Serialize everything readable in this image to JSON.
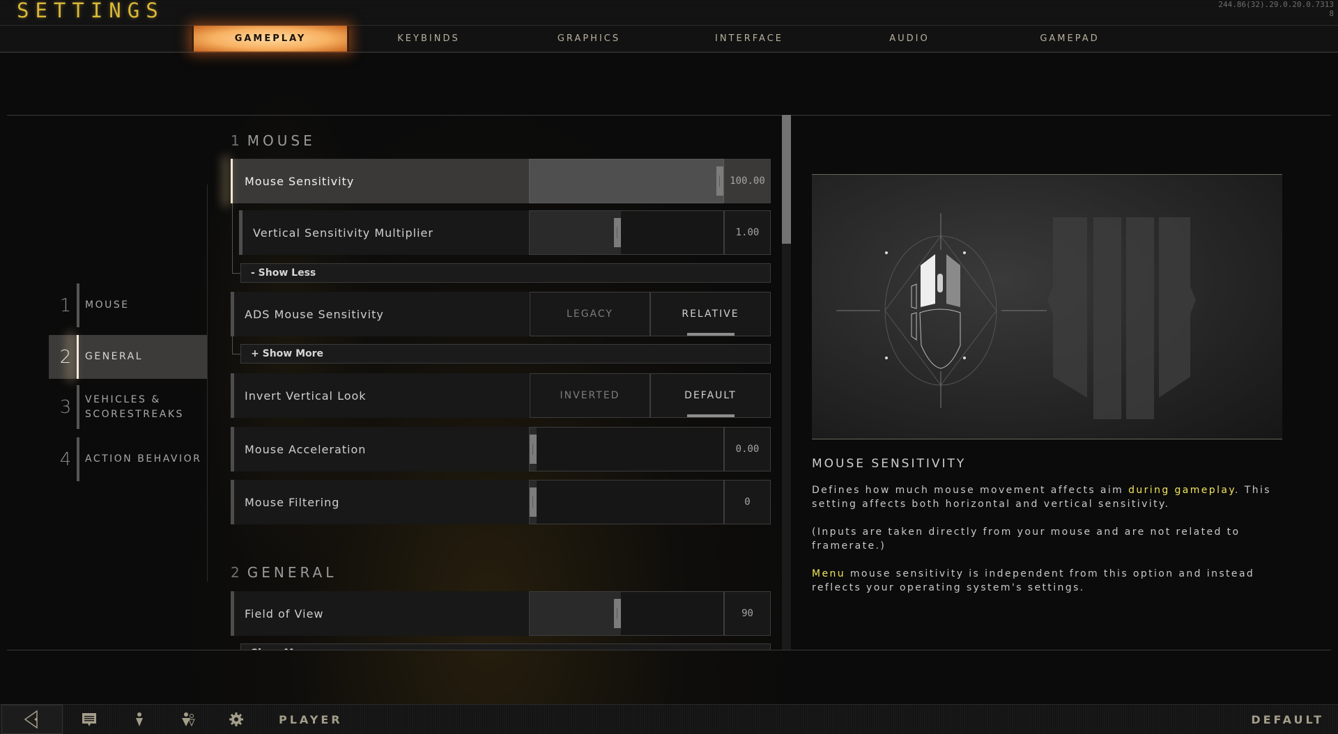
{
  "header": {
    "title": "SETTINGS",
    "build_line1": "244.86(32).29.0.20.0.7313",
    "build_line2": "8"
  },
  "tabs": [
    {
      "label": "GAMEPLAY",
      "active": true
    },
    {
      "label": "KEYBINDS",
      "active": false
    },
    {
      "label": "GRAPHICS",
      "active": false
    },
    {
      "label": "INTERFACE",
      "active": false
    },
    {
      "label": "AUDIO",
      "active": false
    },
    {
      "label": "GAMEPAD",
      "active": false
    }
  ],
  "sidebar": {
    "items": [
      {
        "num": "1",
        "label": "MOUSE",
        "active": false
      },
      {
        "num": "2",
        "label": "GENERAL",
        "active": true
      },
      {
        "num": "3",
        "label": "VEHICLES & SCORESTREAKS",
        "active": false
      },
      {
        "num": "4",
        "label": "ACTION BEHAVIOR",
        "active": false
      }
    ]
  },
  "sections": {
    "mouse": {
      "num": "1",
      "title": "MOUSE"
    },
    "general": {
      "num": "2",
      "title": "GENERAL"
    }
  },
  "settings": {
    "mouse_sensitivity": {
      "label": "Mouse Sensitivity",
      "value": "100.00",
      "fraction": 1.0
    },
    "vertical_multiplier": {
      "label": "Vertical Sensitivity Multiplier",
      "value": "1.00",
      "fraction": 0.47
    },
    "show_less": "- Show Less",
    "ads_sensitivity": {
      "label": "ADS Mouse Sensitivity",
      "options": [
        "LEGACY",
        "RELATIVE"
      ],
      "selected": "RELATIVE"
    },
    "show_more": "+ Show More",
    "invert_look": {
      "label": "Invert Vertical Look",
      "options": [
        "INVERTED",
        "DEFAULT"
      ],
      "selected": "DEFAULT"
    },
    "mouse_acceleration": {
      "label": "Mouse Acceleration",
      "value": "0.00",
      "fraction": 0.0
    },
    "mouse_filtering": {
      "label": "Mouse Filtering",
      "value": "0",
      "fraction": 0.0
    },
    "field_of_view": {
      "label": "Field of View",
      "value": "90",
      "fraction": 0.47
    },
    "next_expander_partial": "Show More"
  },
  "info": {
    "heading": "MOUSE SENSITIVITY",
    "p1_pre": "Defines how much mouse movement affects aim ",
    "p1_hl": "during gameplay",
    "p1_post": ". This setting affects both horizontal and vertical sensitivity.",
    "p2": "(Inputs are taken directly from your mouse and are not related to framerate.)",
    "p3_hl": "Menu",
    "p3_post": " mouse sensitivity is independent from this option and instead reflects your operating system's settings."
  },
  "bottombar": {
    "back_icon": "back-arrow-icon",
    "icons": [
      "chat-icon",
      "player-icon",
      "party-icon",
      "gear-icon"
    ],
    "player_label": "PLAYER",
    "default_label": "DEFAULT"
  },
  "colors": {
    "accent_title": "#d9b73a",
    "tab_active": "#f7b060",
    "highlight_text": "#f2e45a"
  }
}
